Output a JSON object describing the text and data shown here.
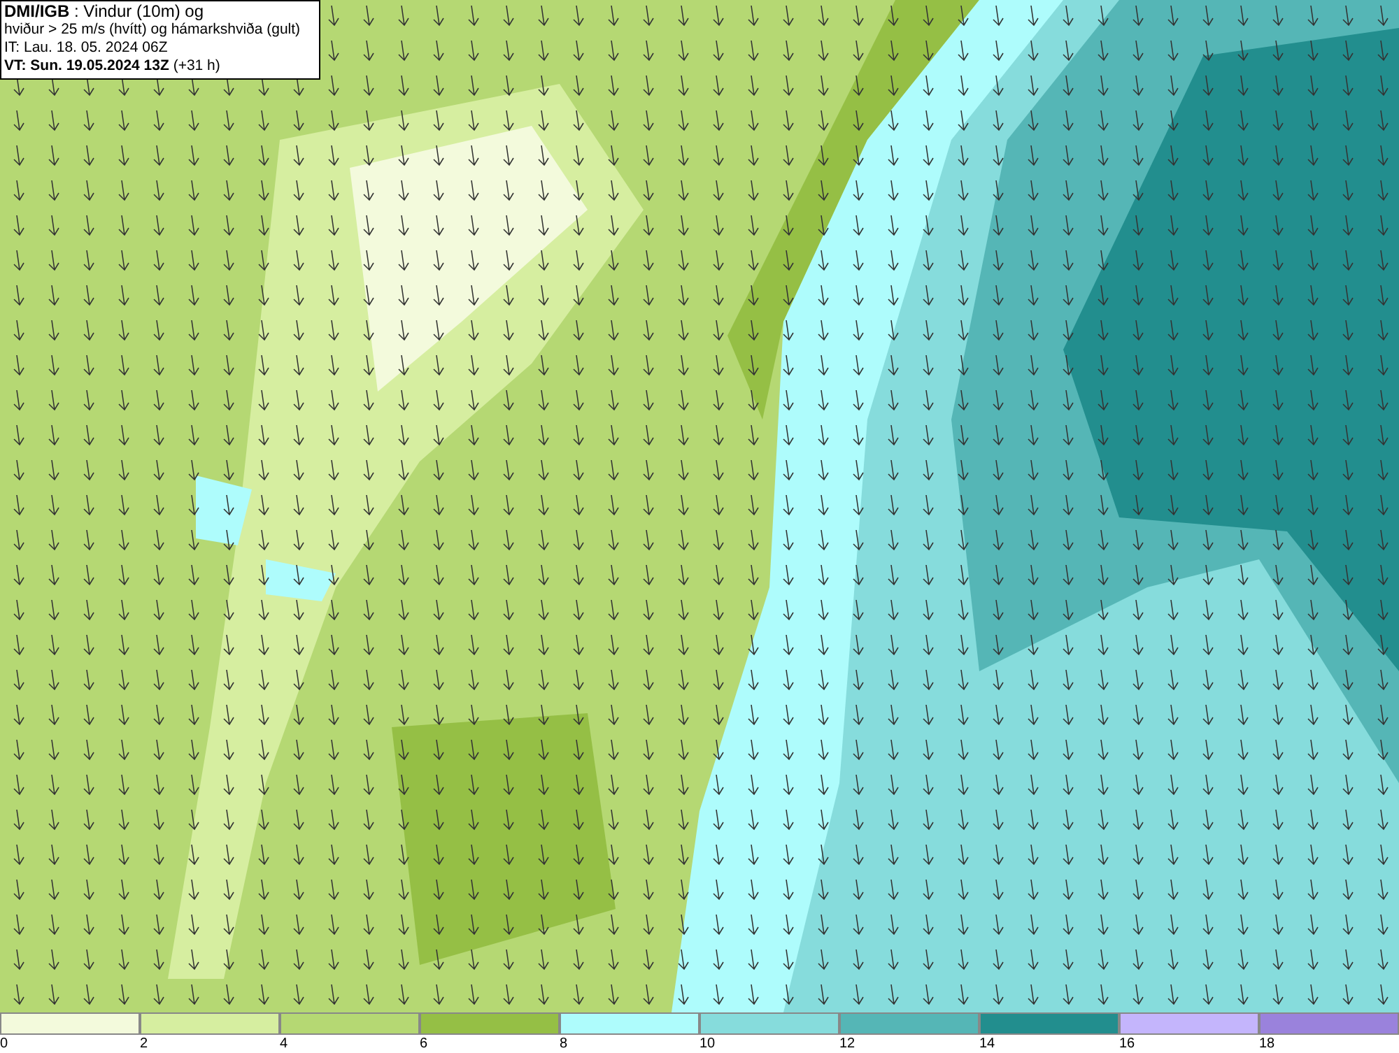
{
  "header": {
    "lines": [
      "**DMI/IGB** : Vindur (10m) og",
      "hviður > 25 m/s (hvítt) og hámarkshviða (gult)",
      "IT: Lau. 18. 05. 2024 06Z",
      "**VT: Sun. 19.05.2024 13Z** (+31 h)"
    ]
  },
  "legend": {
    "bins": [
      {
        "label": "0",
        "color": "#f3fadc"
      },
      {
        "label": "2",
        "color": "#d6eea0"
      },
      {
        "label": "4",
        "color": "#b5d873"
      },
      {
        "label": "6",
        "color": "#95bf45"
      },
      {
        "label": "8",
        "color": "#aefcfc"
      },
      {
        "label": "10",
        "color": "#86dcdc"
      },
      {
        "label": "12",
        "color": "#55b6b6"
      },
      {
        "label": "14",
        "color": "#228e8e"
      },
      {
        "label": "16",
        "color": "#c4b5fc"
      },
      {
        "label": "18",
        "color": "#9a82dc"
      }
    ]
  }
}
